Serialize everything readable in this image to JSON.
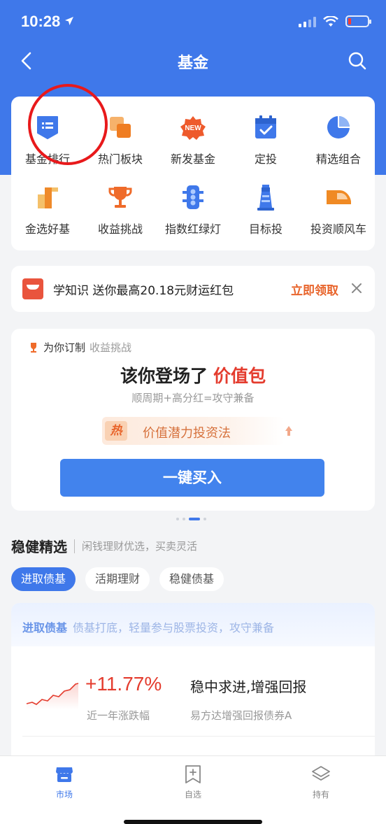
{
  "status_bar": {
    "time": "10:28"
  },
  "nav": {
    "title": "基金"
  },
  "grid": {
    "items": [
      {
        "label": "基金排行",
        "icon": "fund-ranking-icon"
      },
      {
        "label": "热门板块",
        "icon": "hot-sector-icon"
      },
      {
        "label": "新发基金",
        "icon": "new-fund-icon"
      },
      {
        "label": "定投",
        "icon": "calendar-icon"
      },
      {
        "label": "精选组合",
        "icon": "pie-chart-icon"
      },
      {
        "label": "金选好基",
        "icon": "gold-fund-icon"
      },
      {
        "label": "收益挑战",
        "icon": "trophy-icon"
      },
      {
        "label": "指数红绿灯",
        "icon": "traffic-light-icon"
      },
      {
        "label": "目标投",
        "icon": "lighthouse-icon"
      },
      {
        "label": "投资顺风车",
        "icon": "car-icon"
      }
    ],
    "new_badge": "NEW"
  },
  "promo": {
    "text": "学知识 送你最高20.18元财运红包",
    "cta": "立即领取"
  },
  "challenge": {
    "head_title": "为你订制",
    "head_sub": "收益挑战",
    "title": "该你登场了",
    "title_highlight": "价值包",
    "subtitle": "顺周期+高分红=攻守兼备",
    "hot_badge": "热",
    "pill_text": "价值潜力投资法",
    "button": "一键买入"
  },
  "section": {
    "title": "稳健精选",
    "subtitle": "闲钱理财优选，买卖灵活"
  },
  "chips": [
    {
      "label": "进取债基",
      "active": true
    },
    {
      "label": "活期理财",
      "active": false
    },
    {
      "label": "稳健债基",
      "active": false
    }
  ],
  "fund": {
    "band_title": "进取债基",
    "band_sub": "债基打底，轻量参与股票投资，攻守兼备",
    "rate": "+11.77%",
    "rate_label": "近一年涨跌幅",
    "name": "稳中求进,增强回报",
    "sub_name": "易方达增强回报债券A"
  },
  "tabbar": [
    {
      "label": "市场",
      "active": true
    },
    {
      "label": "自选",
      "active": false
    },
    {
      "label": "持有",
      "active": false
    }
  ],
  "colors": {
    "primary": "#3f78ea",
    "red": "#e43c2e",
    "orange": "#e8642b",
    "annotation": "#e8191b"
  }
}
